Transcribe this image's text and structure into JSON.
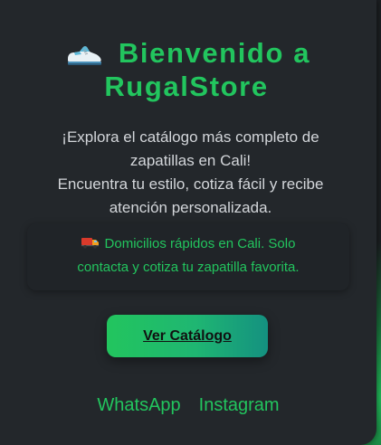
{
  "hero": {
    "icon": "running-shoe-icon",
    "title_line1": "Bienvenido a",
    "title_line2": "RugalStore",
    "accent_color": "#22c55e"
  },
  "intro": {
    "line1": "¡Explora el catálogo más completo de",
    "line2": "zapatillas en Cali!",
    "line3": "Encuentra tu estilo, cotiza fácil y recibe",
    "line4": "atención personalizada."
  },
  "notice": {
    "icon": "delivery-truck-icon",
    "line1": "Domicilios rápidos en Cali. Solo",
    "line2": "contacta y cotiza tu zapatilla favorita."
  },
  "cta": {
    "label": "Ver Catálogo"
  },
  "social": {
    "whatsapp": "WhatsApp",
    "instagram": "Instagram"
  }
}
